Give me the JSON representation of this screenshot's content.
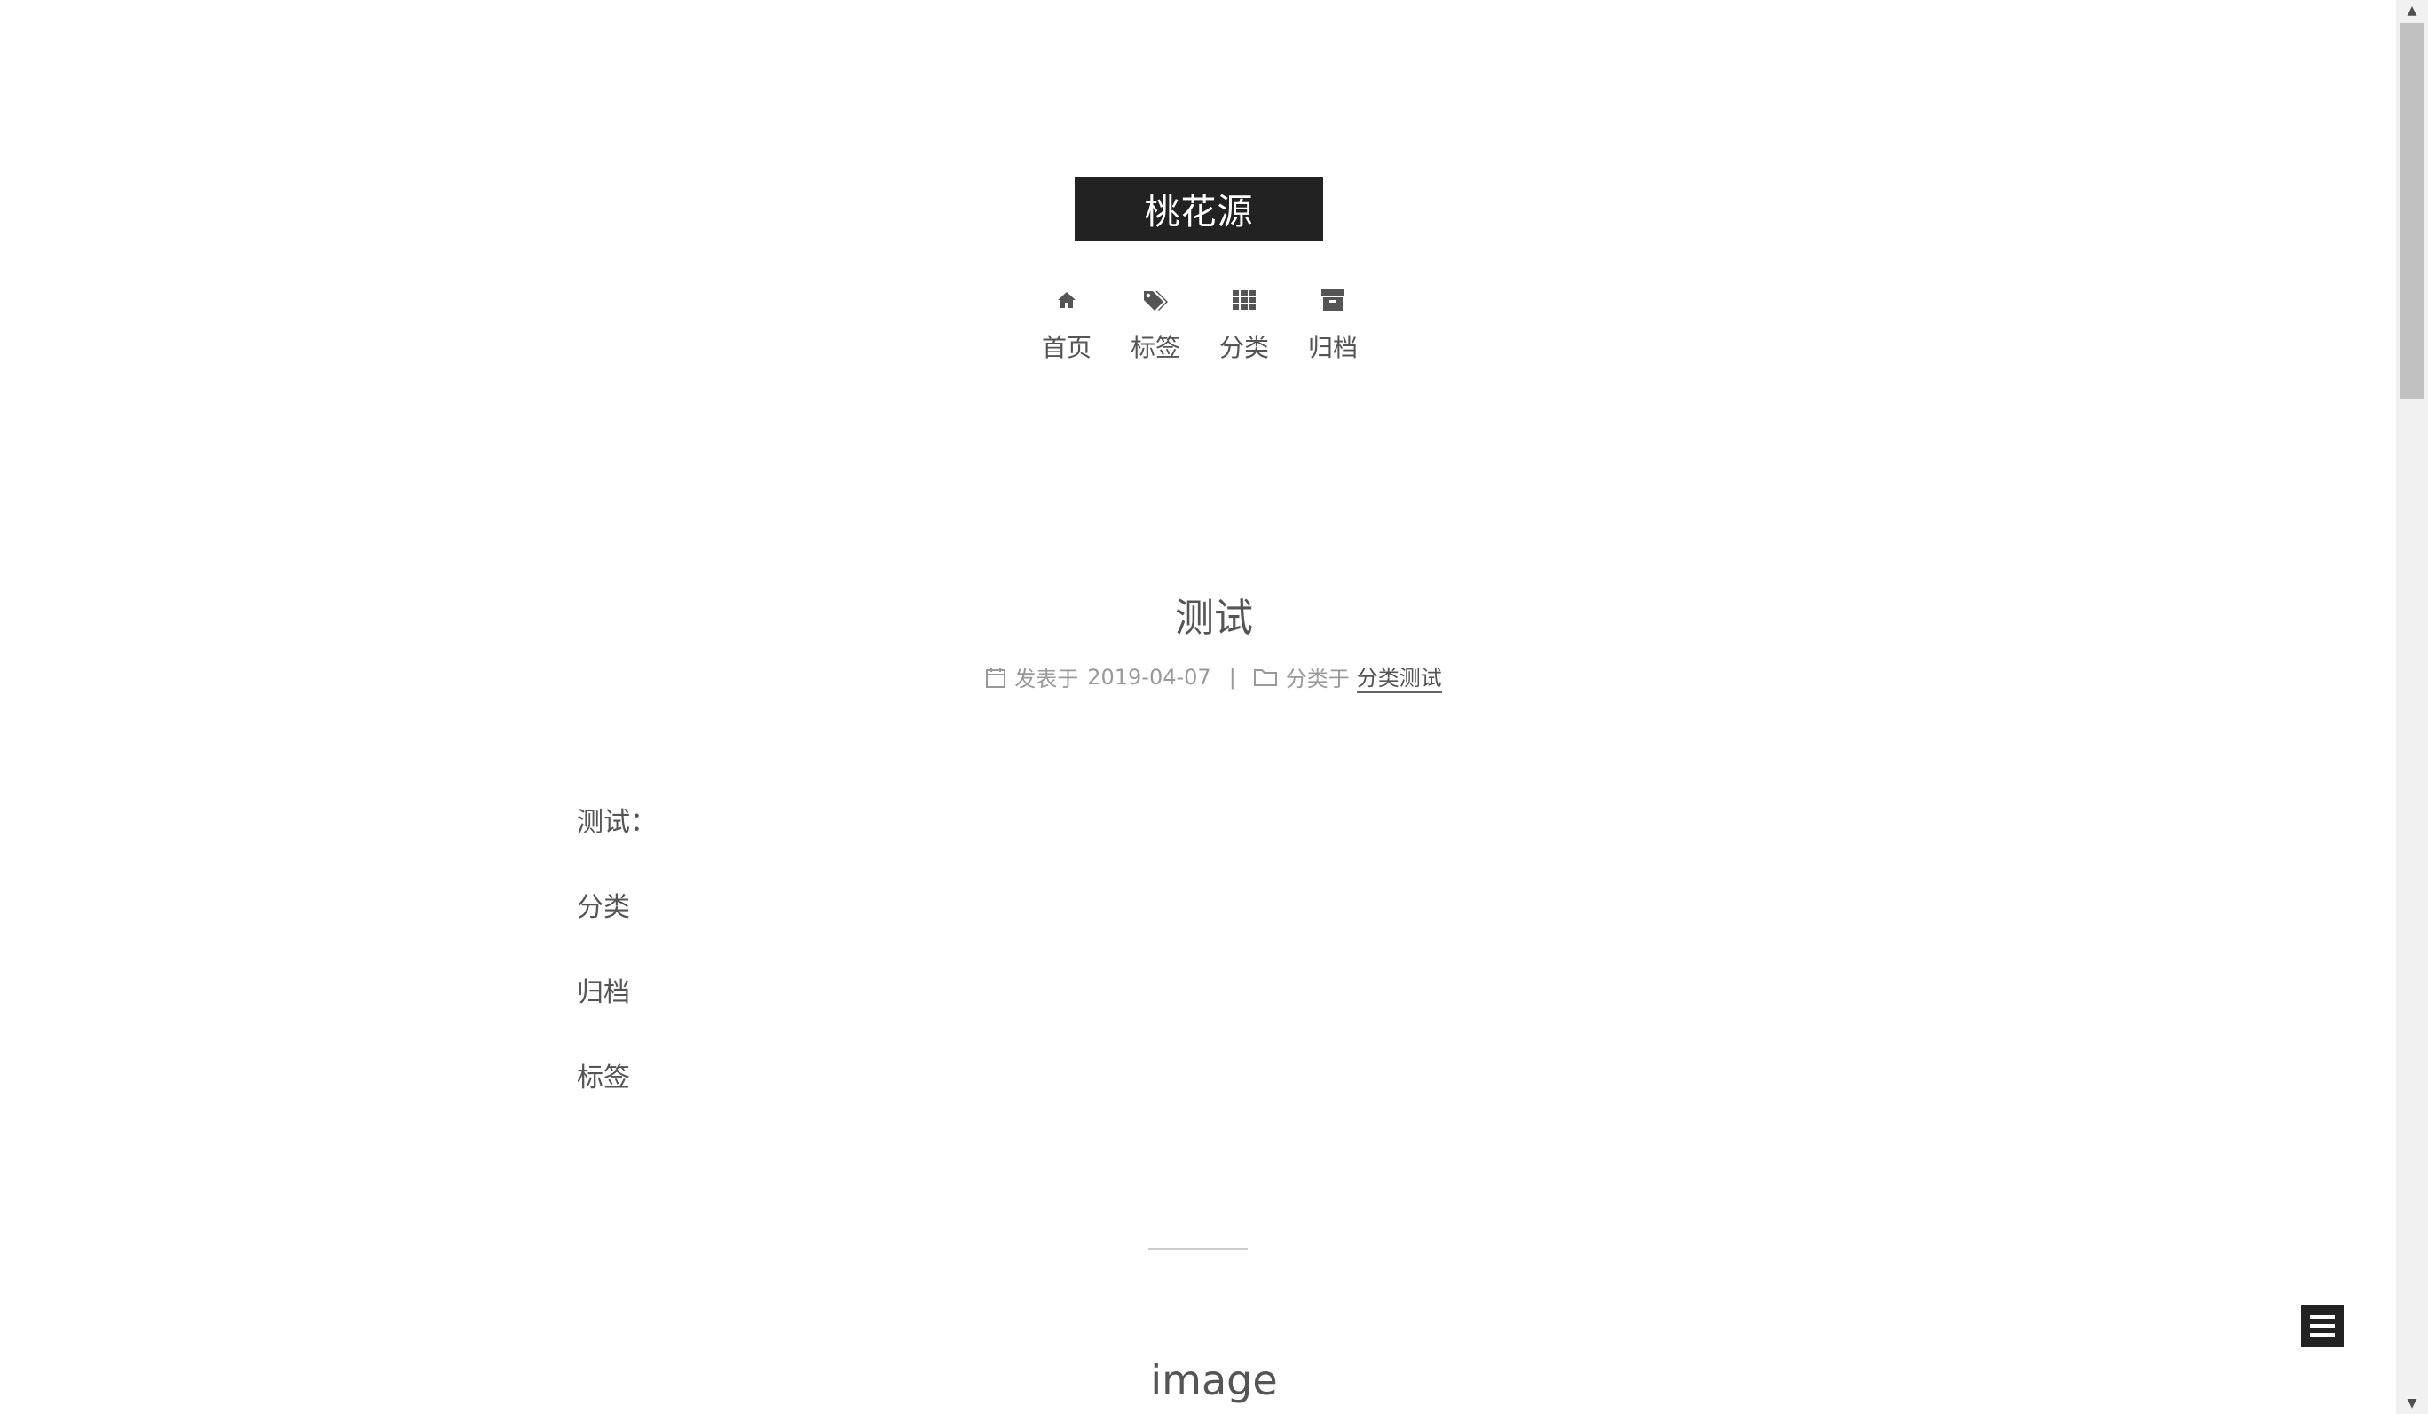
{
  "site": {
    "title": "桃花源"
  },
  "menu": {
    "items": [
      {
        "label": "首页",
        "icon": "home-icon"
      },
      {
        "label": "标签",
        "icon": "tags-icon"
      },
      {
        "label": "分类",
        "icon": "th-icon"
      },
      {
        "label": "归档",
        "icon": "archive-icon"
      }
    ]
  },
  "post": {
    "title": "测试",
    "meta": {
      "posted_prefix": "发表于",
      "date": "2019-04-07",
      "separator": "|",
      "category_prefix": "分类于",
      "category": "分类测试"
    },
    "body": [
      "测试：",
      "分类",
      "归档",
      "标签"
    ]
  },
  "next_post": {
    "title": "image"
  },
  "colors": {
    "brand_bg": "#222222",
    "text": "#555555",
    "meta": "#999999"
  }
}
